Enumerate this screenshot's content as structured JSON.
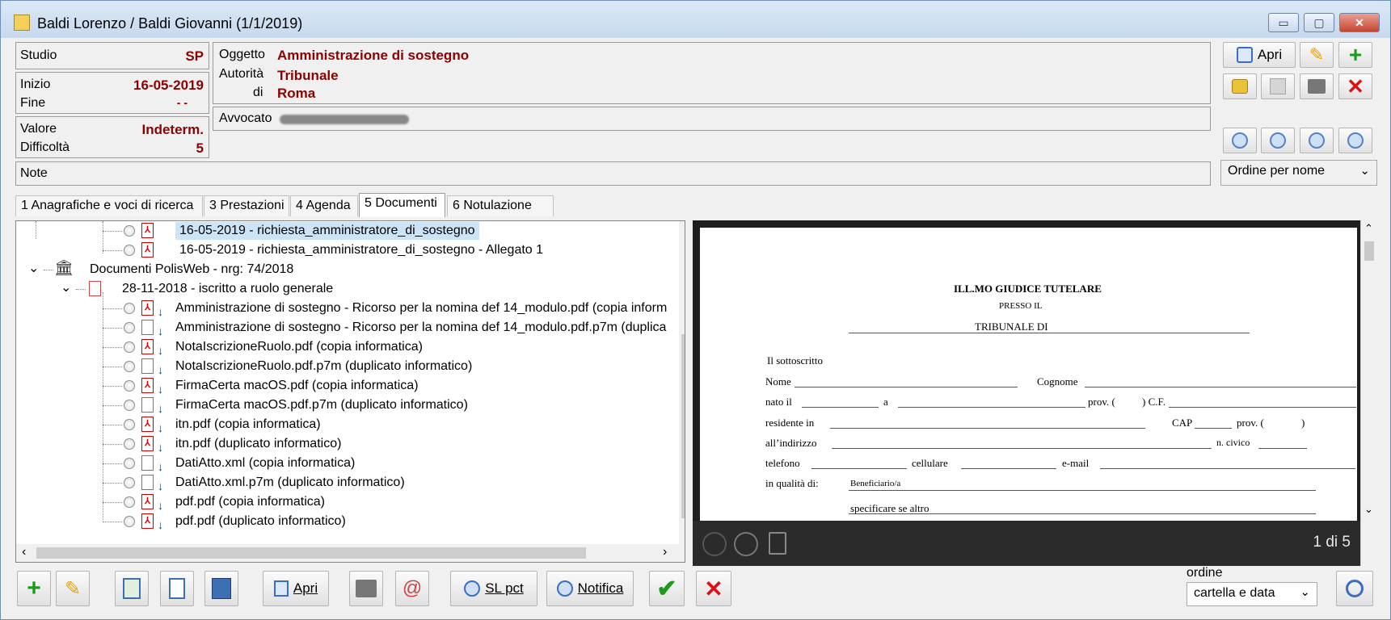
{
  "window": {
    "title": "Baldi Lorenzo / Baldi Giovanni (1/1/2019)",
    "min_glyph": "▭",
    "max_glyph": "▢",
    "close_glyph": "✕"
  },
  "info": {
    "studio_label": "Studio",
    "studio_value": "SP",
    "inizio_label": "Inizio",
    "inizio_value": "16-05-2019",
    "fine_label": "Fine",
    "fine_value": "-  -",
    "valore_label": "Valore",
    "valore_value": "Indeterm.",
    "difficolta_label": "Difficoltà",
    "difficolta_value": "5",
    "note_label": "Note",
    "oggetto_label": "Oggetto",
    "oggetto_value": "Amministrazione di sostegno",
    "autorita_label": "Autorità",
    "autorita_value": "Tribunale",
    "di_label": "di",
    "di_value": "Roma",
    "avvocato_label": "Avvocato"
  },
  "toolbar": {
    "apri_label": "Apri",
    "order_select": "Ordine per nome"
  },
  "tabs": [
    {
      "label": "1 Anagrafiche e voci di ricerca"
    },
    {
      "label": "3 Prestazioni"
    },
    {
      "label": "4 Agenda"
    },
    {
      "label": "5 Documenti"
    },
    {
      "label": "6 Notulazione"
    }
  ],
  "tree": {
    "items": [
      {
        "text": "16-05-2019 - richiesta_amministratore_di_sostegno"
      },
      {
        "text": "16-05-2019 - richiesta_amministratore_di_sostegno - Allegato 1"
      },
      {
        "text": "Documenti PolisWeb - nrg: 74/2018"
      },
      {
        "text": "28-11-2018 - iscritto a ruolo generale"
      },
      {
        "text": "Amministrazione di sostegno - Ricorso per la nomina def 14_modulo.pdf (copia inform"
      },
      {
        "text": "Amministrazione di sostegno - Ricorso per la nomina def 14_modulo.pdf.p7m (duplica"
      },
      {
        "text": "NotaIscrizioneRuolo.pdf (copia informatica)"
      },
      {
        "text": "NotaIscrizioneRuolo.pdf.p7m (duplicato informatico)"
      },
      {
        "text": "FirmaCerta macOS.pdf (copia informatica)"
      },
      {
        "text": "FirmaCerta macOS.pdf.p7m (duplicato informatico)"
      },
      {
        "text": "itn.pdf (copia informatica)"
      },
      {
        "text": "itn.pdf (duplicato informatico)"
      },
      {
        "text": "DatiAtto.xml (copia informatica)"
      },
      {
        "text": "DatiAtto.xml.p7m (duplicato informatico)"
      },
      {
        "text": "pdf.pdf (copia informatica)"
      },
      {
        "text": "pdf.pdf (duplicato informatico)"
      }
    ]
  },
  "viewer": {
    "page_counter": "1 di 5",
    "doc": {
      "title": "ILL.MO GIUDICE TUTELARE",
      "presso": "PRESSO IL",
      "tribunale": "TRIBUNALE DI",
      "sottoscritto": "Il sottoscritto",
      "nome": "Nome",
      "cognome": "Cognome",
      "nato": "nato il",
      "a": "a",
      "prov": "prov. (",
      "cf": ") C.F.",
      "residente": "residente in",
      "cap": "CAP",
      "prov2": "prov. (",
      "prov2_close": ")",
      "indirizzo": "all’indirizzo",
      "civico": "n. civico",
      "telefono": "telefono",
      "cellulare": "cellulare",
      "email": "e-mail",
      "qualita": "in qualità di:",
      "beneficiario": "Beneficiario/a",
      "specificare": "specificare se altro"
    }
  },
  "bottom": {
    "apri_label": "Apri",
    "slpct_label": "SL pct",
    "notifica_label": "Notifica",
    "ordine_label": "ordine",
    "ordine_value": "cartella e data"
  }
}
